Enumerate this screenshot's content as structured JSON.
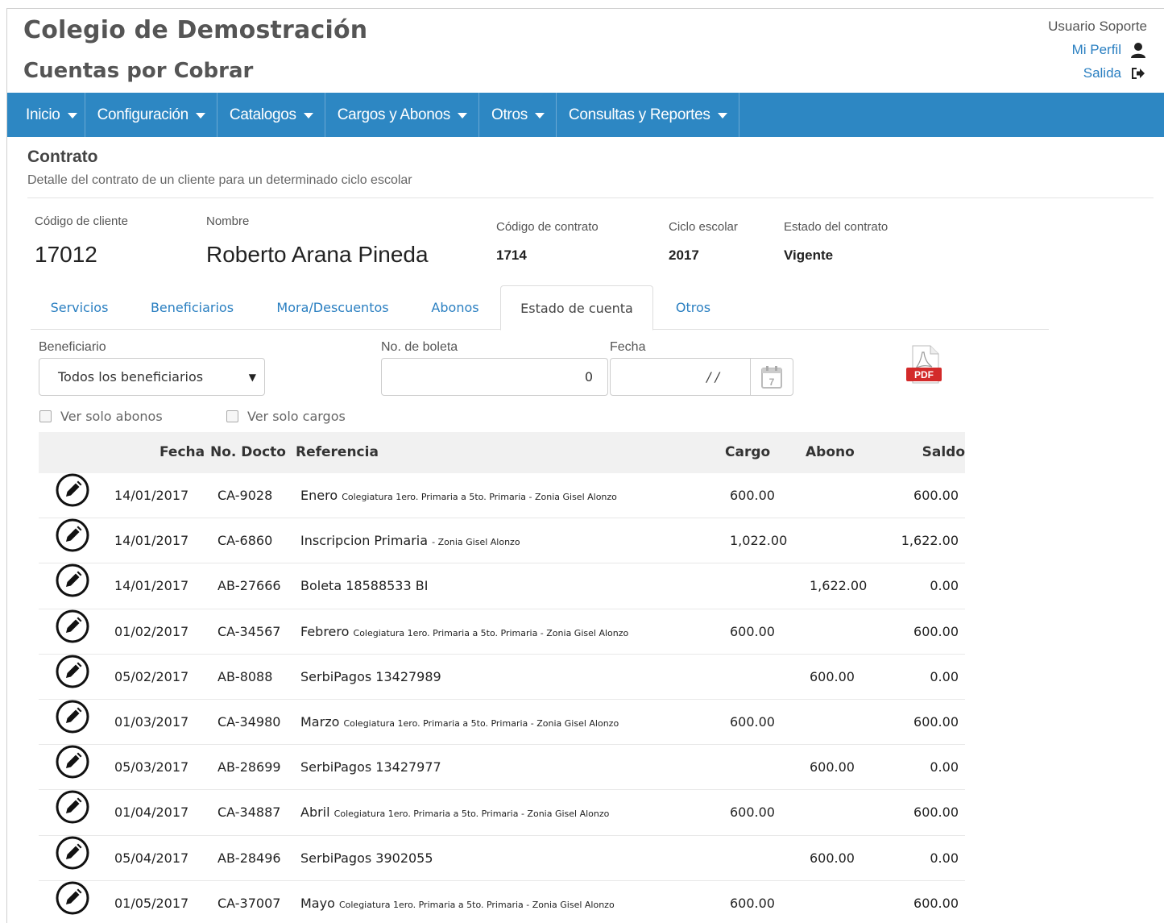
{
  "header": {
    "school": "Colegio de Demostración",
    "module": "Cuentas por Cobrar"
  },
  "user": {
    "name": "Usuario Soporte",
    "profile": "Mi Perfil",
    "logout": "Salida"
  },
  "nav": [
    {
      "label": "Inicio"
    },
    {
      "label": "Configuración"
    },
    {
      "label": "Catalogos"
    },
    {
      "label": "Cargos y Abonos"
    },
    {
      "label": "Otros"
    },
    {
      "label": "Consultas y Reportes"
    }
  ],
  "section": {
    "title": "Contrato",
    "subtitle": "Detalle del contrato de un cliente para un determinado ciclo escolar"
  },
  "contract": {
    "client_code_label": "Código de cliente",
    "client_code": "17012",
    "name_label": "Nombre",
    "name": "Roberto Arana Pineda",
    "contract_code_label": "Código de contrato",
    "contract_code": "1714",
    "cycle_label": "Ciclo escolar",
    "cycle": "2017",
    "status_label": "Estado del contrato",
    "status": "Vigente"
  },
  "tabs": [
    {
      "label": "Servicios",
      "active": false
    },
    {
      "label": "Beneficiarios",
      "active": false
    },
    {
      "label": "Mora/Descuentos",
      "active": false
    },
    {
      "label": "Abonos",
      "active": false
    },
    {
      "label": "Estado de cuenta",
      "active": true
    },
    {
      "label": "Otros",
      "active": false
    }
  ],
  "filters": {
    "beneficiary_label": "Beneficiario",
    "beneficiary_value": "Todos los beneficiarios",
    "boleta_label": "No. de boleta",
    "boleta_value": "0",
    "date_label": "Fecha",
    "date_value": "/ /",
    "only_payments": "Ver solo abonos",
    "only_charges": "Ver solo cargos",
    "pdf_icon": "pdf-icon",
    "pdf_text": "PDF"
  },
  "table": {
    "columns": {
      "fecha": "Fecha",
      "doc": "No. Docto",
      "ref": "Referencia",
      "cargo": "Cargo",
      "abono": "Abono",
      "saldo": "Saldo"
    },
    "rows": [
      {
        "fecha": "14/01/2017",
        "doc": "CA-9028",
        "ref_main": "Enero",
        "ref_detail": "Colegiatura 1ero. Primaria a 5to. Primaria - Zonia Gisel Alonzo",
        "cargo": "600.00",
        "abono": "",
        "saldo": "600.00"
      },
      {
        "fecha": "14/01/2017",
        "doc": "CA-6860",
        "ref_main": "Inscripcion Primaria",
        "ref_detail": "- Zonia Gisel Alonzo",
        "cargo": "1,022.00",
        "abono": "",
        "saldo": "1,622.00"
      },
      {
        "fecha": "14/01/2017",
        "doc": "AB-27666",
        "ref_main": "Boleta 18588533 BI",
        "ref_detail": "",
        "cargo": "",
        "abono": "1,622.00",
        "saldo": "0.00"
      },
      {
        "fecha": "01/02/2017",
        "doc": "CA-34567",
        "ref_main": "Febrero",
        "ref_detail": "Colegiatura 1ero. Primaria a 5to. Primaria - Zonia Gisel Alonzo",
        "cargo": "600.00",
        "abono": "",
        "saldo": "600.00"
      },
      {
        "fecha": "05/02/2017",
        "doc": "AB-8088",
        "ref_main": "SerbiPagos 13427989",
        "ref_detail": "",
        "cargo": "",
        "abono": "600.00",
        "saldo": "0.00"
      },
      {
        "fecha": "01/03/2017",
        "doc": "CA-34980",
        "ref_main": "Marzo",
        "ref_detail": "Colegiatura 1ero. Primaria a 5to. Primaria - Zonia Gisel Alonzo",
        "cargo": "600.00",
        "abono": "",
        "saldo": "600.00"
      },
      {
        "fecha": "05/03/2017",
        "doc": "AB-28699",
        "ref_main": "SerbiPagos 13427977",
        "ref_detail": "",
        "cargo": "",
        "abono": "600.00",
        "saldo": "0.00"
      },
      {
        "fecha": "01/04/2017",
        "doc": "CA-34887",
        "ref_main": "Abril",
        "ref_detail": "Colegiatura 1ero. Primaria a 5to. Primaria - Zonia Gisel Alonzo",
        "cargo": "600.00",
        "abono": "",
        "saldo": "600.00"
      },
      {
        "fecha": "05/04/2017",
        "doc": "AB-28496",
        "ref_main": "SerbiPagos 3902055",
        "ref_detail": "",
        "cargo": "",
        "abono": "600.00",
        "saldo": "0.00"
      },
      {
        "fecha": "01/05/2017",
        "doc": "CA-37007",
        "ref_main": "Mayo",
        "ref_detail": "Colegiatura 1ero. Primaria a 5to. Primaria - Zonia Gisel Alonzo",
        "cargo": "600.00",
        "abono": "",
        "saldo": "600.00"
      }
    ]
  },
  "colors": {
    "navbar": "#2d87c3",
    "link": "#2a7fc1",
    "pdf_red": "#d32a2a"
  }
}
